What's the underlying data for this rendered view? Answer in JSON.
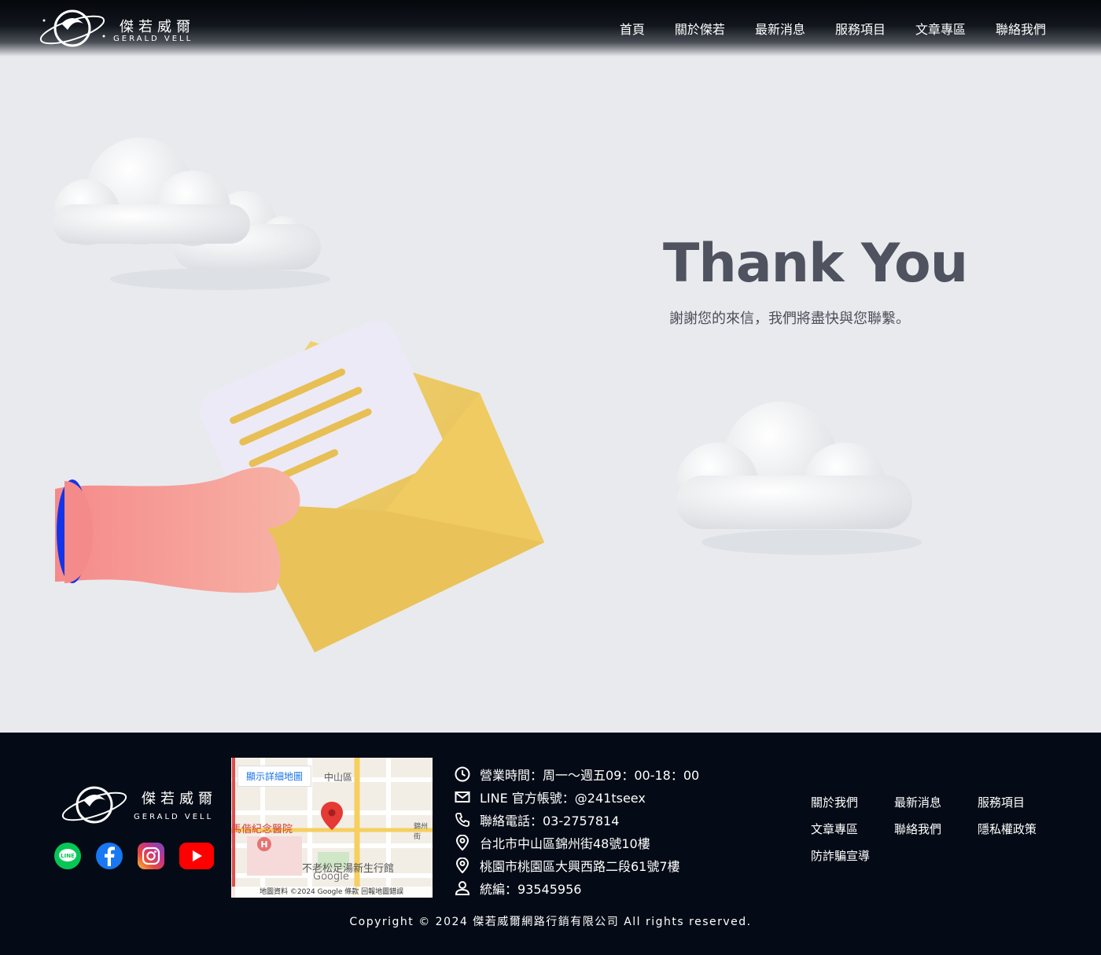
{
  "header": {
    "logo_cn": "傑若威爾",
    "logo_en": "GERALD VELL",
    "nav": [
      "首頁",
      "關於傑若",
      "最新消息",
      "服務項目",
      "文章專區",
      "聯絡我們"
    ]
  },
  "hero": {
    "title": "Thank You",
    "subtitle": "謝謝您的來信，我們將盡快與您聯繫。"
  },
  "footer": {
    "logo_cn": "傑若威爾",
    "logo_en": "GERALD VELL",
    "social": [
      "line-icon",
      "facebook-icon",
      "instagram-icon",
      "youtube-icon"
    ],
    "map": {
      "button": "顯示詳細地圖",
      "label_district": "中山區",
      "label_hospital": "馬偕紀念醫院",
      "label_place": "不老松足湯新生行館",
      "label_street": "錦州街",
      "credit": "地圖資料 ©2024 Google   條款   回報地圖錯誤",
      "google": "Google"
    },
    "info": [
      {
        "icon": "clock-icon",
        "text": "營業時間：周一～週五09：00-18：00"
      },
      {
        "icon": "mail-icon",
        "text": "LINE 官方帳號：@241tseex"
      },
      {
        "icon": "phone-icon",
        "text": "聯絡電話：03-2757814"
      },
      {
        "icon": "location-icon",
        "text": "台北市中山區錦州街48號10樓"
      },
      {
        "icon": "location-icon",
        "text": "桃園市桃園區大興西路二段61號7樓"
      },
      {
        "icon": "person-icon",
        "text": "統編：93545956"
      }
    ],
    "links": [
      "關於我們",
      "最新消息",
      "服務項目",
      "文章專區",
      "聯絡我們",
      "隱私權政策",
      "防詐騙宣導"
    ],
    "copyright": "Copyright © 2024 傑若威爾網路行銷有限公司 All rights reserved."
  }
}
